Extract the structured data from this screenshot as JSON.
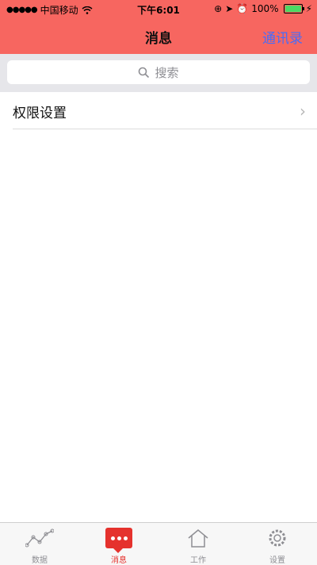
{
  "status_bar": {
    "carrier": "中国移动",
    "time": "下午6:01",
    "battery": "100%"
  },
  "nav": {
    "title": "消息",
    "right_action": "通讯录"
  },
  "search": {
    "placeholder": "搜索"
  },
  "list": [
    {
      "label": "权限设置"
    }
  ],
  "tabs": [
    {
      "label": "数据",
      "icon": "line-chart-icon",
      "active": false
    },
    {
      "label": "消息",
      "icon": "message-bubble-icon",
      "active": true
    },
    {
      "label": "工作",
      "icon": "home-icon",
      "active": false
    },
    {
      "label": "设置",
      "icon": "gear-icon",
      "active": false
    }
  ],
  "colors": {
    "header": "#f76660",
    "accent": "#e5322d",
    "link": "#4a6cf7"
  }
}
